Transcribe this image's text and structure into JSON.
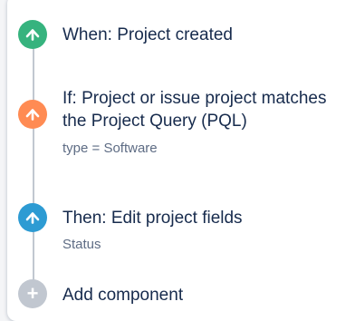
{
  "colors": {
    "trigger": "#36b37e",
    "condition": "#ff8b53",
    "action": "#2d9bd3",
    "add": "#c1c7d0"
  },
  "rule": {
    "trigger": {
      "icon": "automation-icon",
      "title": "When: Project created"
    },
    "condition": {
      "icon": "automation-icon",
      "title": "If: Project or issue project matches\nthe Project Query (PQL)",
      "detail": "type = Software"
    },
    "action": {
      "icon": "automation-icon",
      "title": "Then: Edit project fields",
      "detail": "Status"
    },
    "add_component": {
      "icon": "plus-icon",
      "label": "Add component"
    }
  }
}
